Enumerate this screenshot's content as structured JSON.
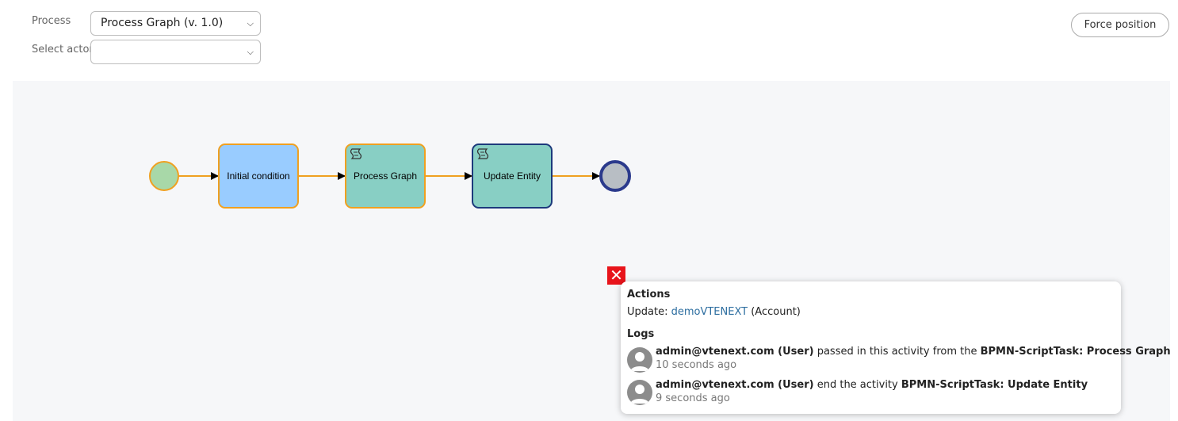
{
  "header": {
    "process_label": "Process",
    "process_value": "Process Graph (v. 1.0)",
    "actor_label": "Select actor",
    "actor_value": "",
    "force_button": "Force position"
  },
  "diagram": {
    "nodes": [
      {
        "label": "Initial condition",
        "color": "#99ccff",
        "border": "#f0a020"
      },
      {
        "label": "Process Graph",
        "color": "#88cfc4",
        "border": "#f0a020"
      },
      {
        "label": "Update Entity",
        "color": "#88cfc4",
        "border": "#1d3a7c"
      }
    ],
    "start_event_color": "#a8d8a8",
    "end_event_color": "#b8bec4"
  },
  "popup": {
    "close_label": "✕",
    "actions_title": "Actions",
    "update_prefix": "Update:",
    "update_link": "demoVTENEXT",
    "update_suffix": "(Account)",
    "logs_title": "Logs",
    "logs": [
      {
        "user": "admin@vtenext.com (User)",
        "text": "passed in this activity from the",
        "target": "BPMN-ScriptTask: Process Graph",
        "time": "10 seconds ago"
      },
      {
        "user": "admin@vtenext.com (User)",
        "text": "end the activity",
        "target": "BPMN-ScriptTask: Update Entity",
        "time": "9 seconds ago"
      }
    ]
  }
}
